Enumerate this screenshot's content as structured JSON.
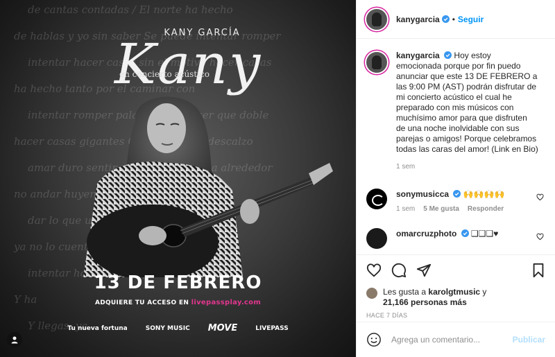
{
  "poster": {
    "brand": "KANY GARCÍA",
    "script_title": "Kany",
    "subtitle": "en concierto acústico",
    "date": "13 DE FEBRERO",
    "access_prefix": "ADQUIERE TU ACCESO EN ",
    "access_link": "livepassplay.com",
    "logos": [
      "Tu nueva fortuna",
      "SONY MUSIC",
      "MOVE",
      "LIVEPASS"
    ],
    "bg_lines": [
      "de cantas contadas / El norte ha hecho",
      "de hablas y yo sin saber   Se puede intentar romper",
      "intentar hacer casas   sin el motivo hacer casas",
      "ha hecho tanto por el   caminar con",
      "intentar romper palabras   Sin si ser que doble",
      "hacer casas gigantes   Quieren andar descalzo",
      "amar duro sentir que   Llorar la pena alrededor",
      "no andar huyendo   de llamadas de",
      "dar lo que un dia   Para volver a amar al",
      "ya no lo cuento   Y no anda",
      "intentar hacer   que lo poderte dar",
      "   Y ha",
      "   Y llegas, ya"
    ]
  },
  "panel": {
    "username": "kanygarcia",
    "follow_label": "Seguir",
    "caption_text": "Hoy estoy emocionada porque por fin puedo anunciar que este 13 DE FEBRERO a las 9:00 PM (AST) podrán disfrutar de mi concierto acústico el cual he preparado con mis músicos con muchísimo amor para que disfruten de una noche inolvidable con sus parejas o amigos! Porque celebramos todas las caras del amor! (Link en Bio)",
    "caption_time": "1 sem",
    "comments": [
      {
        "user": "sonymusicca",
        "text": "🙌🙌🙌🙌",
        "time": "1 sem",
        "likes": "5 Me gusta",
        "reply": "Responder"
      },
      {
        "user": "omarcruzphoto",
        "text": "❑❑❑♥"
      }
    ],
    "liked_by_prefix": "Les gusta a ",
    "liked_by_user": "karolgtmusic",
    "liked_by_mid": " y",
    "liked_count": "21,166 personas más",
    "posted_ago": "HACE 7 DÍAS",
    "comment_placeholder": "Agrega un comentario...",
    "publish_label": "Publicar"
  },
  "colors": {
    "accent_blue": "#0095f6",
    "publish_disabled": "#b2dffc",
    "meta_gray": "#8e8e8e",
    "link_pink": "#e2368e"
  }
}
